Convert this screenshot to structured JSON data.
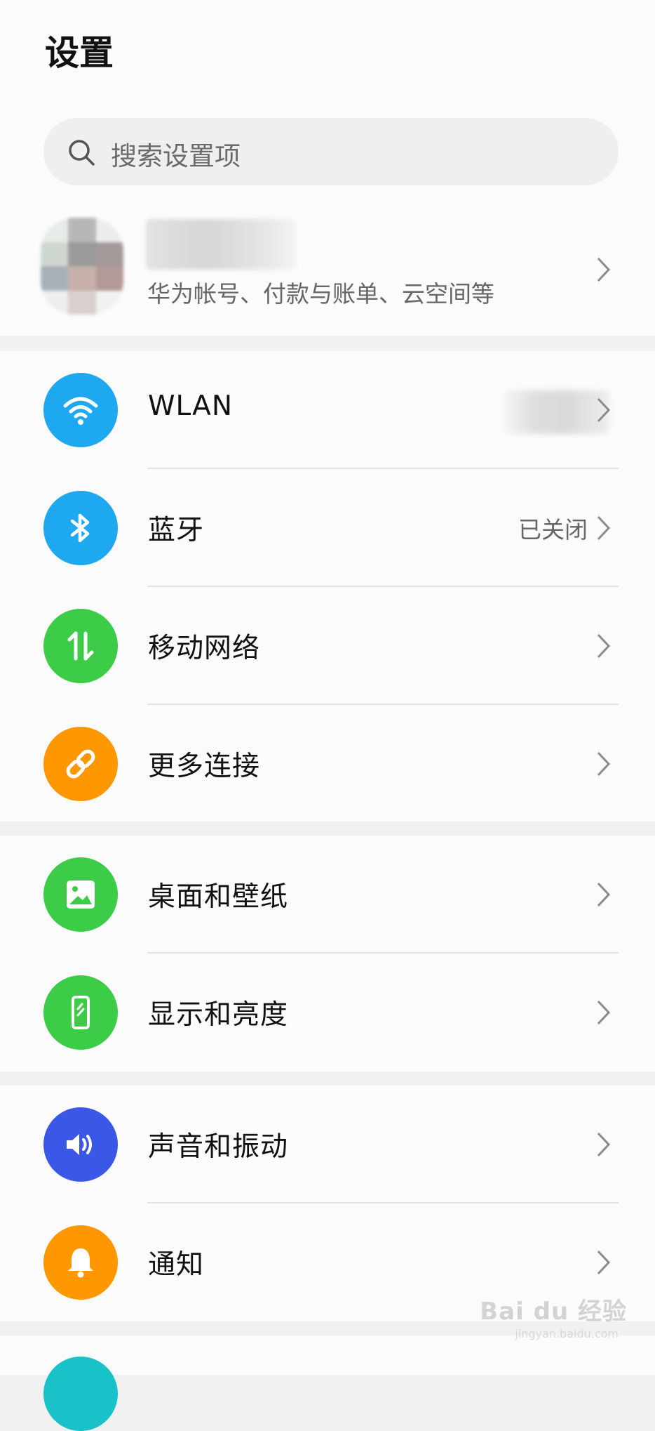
{
  "page": {
    "title": "设置"
  },
  "search": {
    "placeholder": "搜索设置项"
  },
  "account": {
    "subtitle": "华为帐号、付款与账单、云空间等"
  },
  "sections": [
    {
      "items": [
        {
          "label": "WLAN",
          "value": "",
          "icon": "wifi-icon",
          "color": "#1ea8f0"
        },
        {
          "label": "蓝牙",
          "value": "已关闭",
          "icon": "bluetooth-icon",
          "color": "#1ea8f0"
        },
        {
          "label": "移动网络",
          "value": "",
          "icon": "mobile-data-icon",
          "color": "#3ccc48"
        },
        {
          "label": "更多连接",
          "value": "",
          "icon": "link-icon",
          "color": "#ff9800"
        }
      ]
    },
    {
      "items": [
        {
          "label": "桌面和壁纸",
          "value": "",
          "icon": "wallpaper-icon",
          "color": "#3ccc48"
        },
        {
          "label": "显示和亮度",
          "value": "",
          "icon": "display-icon",
          "color": "#3ccc48"
        }
      ]
    },
    {
      "items": [
        {
          "label": "声音和振动",
          "value": "",
          "icon": "sound-icon",
          "color": "#3a57e8"
        },
        {
          "label": "通知",
          "value": "",
          "icon": "bell-icon",
          "color": "#ff9800"
        }
      ]
    }
  ],
  "watermark": {
    "brand": "Bai du 经验",
    "url": "jingyan.baidu.com"
  }
}
